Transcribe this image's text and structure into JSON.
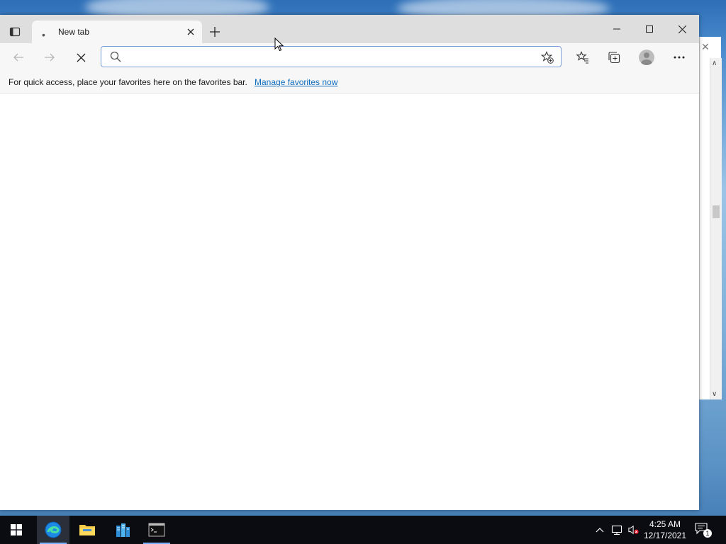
{
  "browser": {
    "tab_title": "New tab",
    "address_value": "",
    "address_placeholder": ""
  },
  "favorites_bar": {
    "message": "For quick access, place your favorites here on the favorites bar.",
    "link_label": "Manage favorites now"
  },
  "taskbar": {
    "apps": [
      "start",
      "edge",
      "file-explorer",
      "server-manager",
      "terminal"
    ],
    "time": "4:25 AM",
    "date": "12/17/2021",
    "notification_count": "1"
  },
  "colors": {
    "accent": "#0f6cbd",
    "taskbar": "#0b0b12",
    "titlebar": "#dedede"
  }
}
